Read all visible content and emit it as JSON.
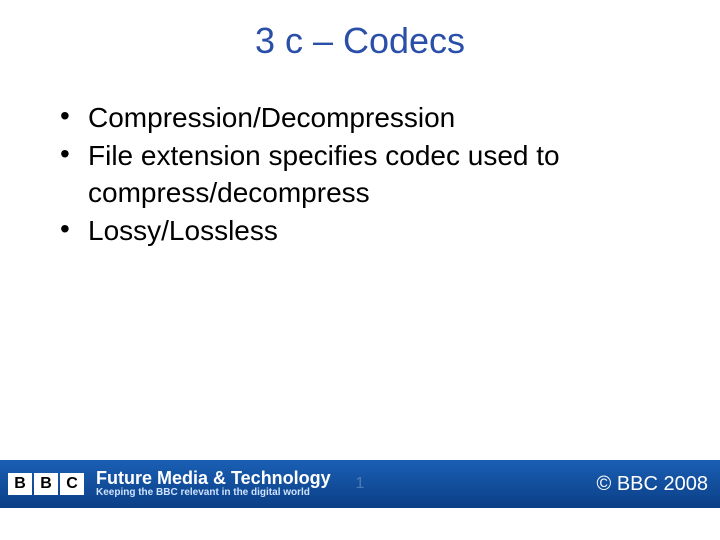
{
  "title": "3 c – Codecs",
  "bullets": [
    "Compression/Decompression",
    "File extension specifies codec used to compress/decompress",
    "Lossy/Lossless"
  ],
  "footer": {
    "logo_letters": [
      "B",
      "B",
      "C"
    ],
    "main": "Future Media & Technology",
    "sub": "Keeping the BBC relevant in the digital world",
    "slide_number": "1",
    "copyright": "© BBC 2008"
  }
}
